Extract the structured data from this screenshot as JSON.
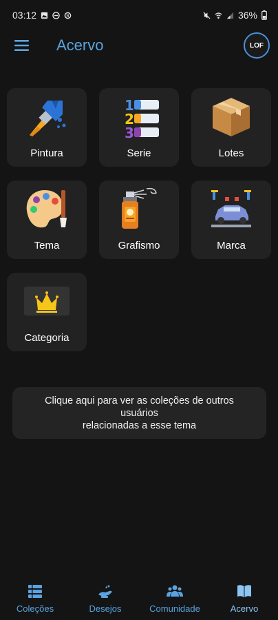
{
  "status_bar": {
    "time": "03:12",
    "battery": "36%"
  },
  "app_bar": {
    "title": "Acervo",
    "logo_text": "LOF"
  },
  "tiles": [
    {
      "label": "Pintura",
      "icon": "paint-brush-icon"
    },
    {
      "label": "Serie",
      "icon": "numbered-list-icon"
    },
    {
      "label": "Lotes",
      "icon": "box-icon"
    },
    {
      "label": "Tema",
      "icon": "palette-icon"
    },
    {
      "label": "Grafismo",
      "icon": "spray-can-icon"
    },
    {
      "label": "Marca",
      "icon": "car-lift-icon"
    },
    {
      "label": "Categoria",
      "icon": "crown-icon"
    }
  ],
  "info_box": {
    "line1": "Clique aqui para ver as coleções de outros",
    "line2": "usuários",
    "line3": "relacionadas a esse tema"
  },
  "bottom_nav": [
    {
      "label": "Coleções",
      "icon": "list-icon"
    },
    {
      "label": "Desejos",
      "icon": "lamp-icon"
    },
    {
      "label": "Comunidade",
      "icon": "people-icon"
    },
    {
      "label": "Acervo",
      "icon": "book-icon"
    }
  ],
  "colors": {
    "accent": "#5aa3e0",
    "background": "#141414",
    "tile": "#222222"
  }
}
